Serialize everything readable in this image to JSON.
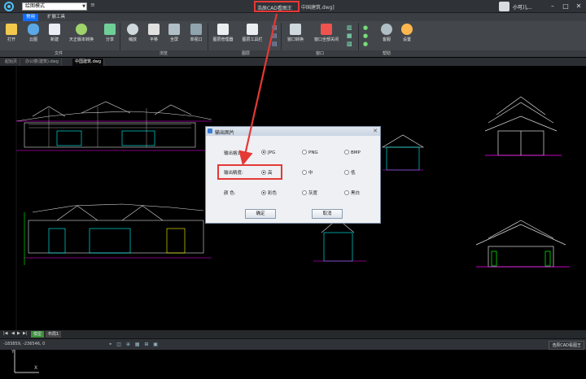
{
  "titlebar": {
    "mode": "绘图模式",
    "app_title": "浩辰CAD看图王",
    "file_title": "中国建筑.dwg]",
    "user_name": "小可儿..."
  },
  "ribbon_tabs": [
    "常用",
    "扩展工具"
  ],
  "ribbon": {
    "buttons": [
      "打开",
      "云图",
      "新建",
      "天正版本转换",
      "分享",
      "缩放",
      "平移",
      "全屏",
      "单视口",
      "图层管理器",
      "图层工具栏",
      "窗口转换",
      "窗口全部关闭",
      "客服",
      "设置"
    ],
    "groups": [
      "文件",
      "浏览",
      "图层",
      "窗口",
      "帮助"
    ]
  },
  "doc_tabs": [
    "起始页",
    "办公楼(建筑).dwg",
    "中国建筑.dwg"
  ],
  "layout_tabs": [
    "模型",
    "布局1"
  ],
  "status": {
    "coords": "-183859, -236546, 0",
    "app_label": "浩辰CAD看图王"
  },
  "dialog": {
    "title": "输出图片",
    "format_label": "输出格式:",
    "formats": [
      "JPG",
      "PNG",
      "BMP"
    ],
    "quality_label": "输出精度:",
    "qualities": [
      "高",
      "中",
      "低"
    ],
    "color_label": "颜    色:",
    "colors": [
      "彩色",
      "灰度",
      "黑白"
    ],
    "ok": "确定",
    "cancel": "取消",
    "selected": {
      "format": "JPG",
      "quality": "高",
      "color": "彩色"
    }
  },
  "colors": {
    "highlight": "#e53935",
    "accent": "#0d6efd"
  },
  "icons": [
    "app-logo-icon",
    "open-icon",
    "cloud-icon",
    "new-icon",
    "convert-icon",
    "share-icon",
    "zoom-icon",
    "pan-icon",
    "fullscreen-icon",
    "viewport-icon",
    "layer-manager-icon",
    "layer-toolbar-icon",
    "window-switch-icon",
    "close-all-icon",
    "service-icon",
    "settings-icon"
  ]
}
